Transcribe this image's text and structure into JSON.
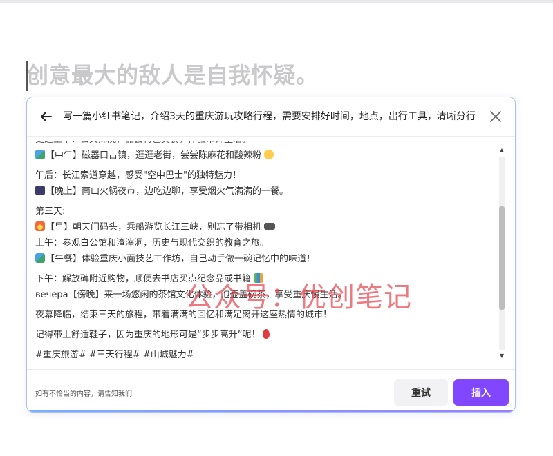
{
  "editor": {
    "heading": "创意最大的敌人是自我怀疑。"
  },
  "dialog": {
    "prompt": "写一篇小红书笔记，介绍3天的重庆游玩攻略行程，需要安排好时间，地点，出行工具，清晰分行",
    "content": {
      "partial_line": "更适上午：去文殊院，品尝特色美食，体验市井生活。",
      "lines": [
        {
          "emoji": "image",
          "text": "【中午】磁器口古镇，逛逛老街，尝尝陈麻花和酸辣粉",
          "trail": "face",
          "gap": false
        },
        {
          "emoji": "",
          "text": "午后：长江索道穿越，感受\"空中巴士\"的独特魅力！",
          "trail": "",
          "gap": true
        },
        {
          "emoji": "night",
          "text": "【晚上】南山火锅夜市，边吃边聊，享受烟火气满满的一餐。",
          "trail": "",
          "gap": false
        },
        {
          "emoji": "",
          "text": "第三天:",
          "trail": "",
          "gap": true
        },
        {
          "emoji": "sunrise",
          "text": "【早】朝天门码头，乘船游览长江三峡，别忘了带相机",
          "trail": "camera",
          "gap": false
        },
        {
          "emoji": "",
          "text": "上午：参观白公馆和渣滓洞，历史与现代交织的教育之旅。",
          "trail": "",
          "gap": false
        },
        {
          "emoji": "image",
          "text": "【午餐】体验重庆小面技艺工作坊，自己动手做一碗记忆中的味道！",
          "trail": "",
          "gap": false
        },
        {
          "emoji": "",
          "text": "下午：解放碑附近购物，顺便去书店买点纪念品或书籍",
          "trail": "books",
          "gap": true
        },
        {
          "emoji": "",
          "text": "вечера【傍晚】来一场悠闲的茶馆文化体验，泡壶盖碗茶，享受重庆慢生活。",
          "trail": "",
          "gap": false
        },
        {
          "emoji": "",
          "text": "夜幕降临，结束三天的旅程，带着满满的回忆和满足离开这座热情的城市！",
          "trail": "",
          "gap": true
        },
        {
          "emoji": "",
          "text": "记得带上舒适鞋子，因为重庆的地形可是“步步高升”呢！",
          "trail": "balloon",
          "gap": true
        },
        {
          "emoji": "",
          "text": "#重庆旅游# #三天行程# #山城魅力#",
          "trail": "",
          "gap": true
        }
      ]
    },
    "scroll_position": 0.55,
    "report_link": "如有不恰当的内容，请告知我们",
    "retry_label": "重试",
    "insert_label": "插入"
  },
  "watermark": "公众号：优创笔记",
  "colors": {
    "accent": "#8146ff",
    "dialog_border": "#a9bff2",
    "watermark": "#e64650"
  }
}
